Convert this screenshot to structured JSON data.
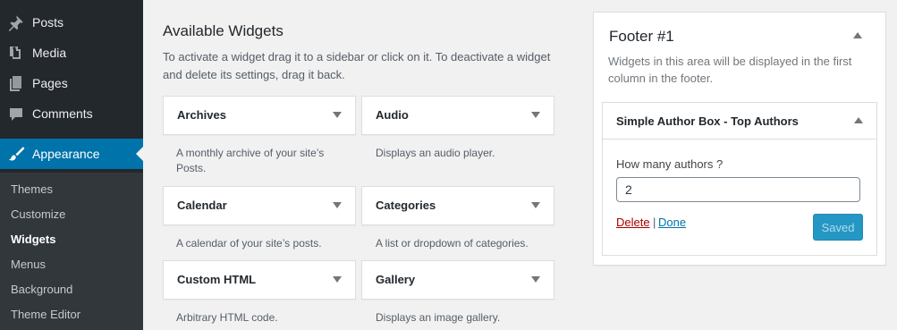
{
  "sidebar": {
    "menu": [
      {
        "label": "Posts",
        "icon": "pushpin-icon"
      },
      {
        "label": "Media",
        "icon": "media-icon"
      },
      {
        "label": "Pages",
        "icon": "pages-icon"
      },
      {
        "label": "Comments",
        "icon": "comment-icon"
      },
      {
        "label": "Appearance",
        "icon": "paintbrush-icon",
        "active": true
      }
    ],
    "submenu": [
      "Themes",
      "Customize",
      "Widgets",
      "Menus",
      "Background",
      "Theme Editor"
    ],
    "current_submenu": "Widgets"
  },
  "available": {
    "title": "Available Widgets",
    "description": "To activate a widget drag it to a sidebar or click on it. To deactivate a widget and delete its settings, drag it back.",
    "widgets": [
      {
        "title": "Archives",
        "description": "A monthly archive of your site’s Posts."
      },
      {
        "title": "Audio",
        "description": "Displays an audio player."
      },
      {
        "title": "Calendar",
        "description": "A calendar of your site’s posts."
      },
      {
        "title": "Categories",
        "description": "A list or dropdown of categories."
      },
      {
        "title": "Custom HTML",
        "description": "Arbitrary HTML code."
      },
      {
        "title": "Gallery",
        "description": "Displays an image gallery."
      }
    ]
  },
  "footer_sidebar": {
    "title": "Footer #1",
    "description": "Widgets in this area will be displayed in the first column in the footer.",
    "widget": {
      "title": "Simple Author Box - Top Authors",
      "field_label": "How many authors ?",
      "field_value": "2",
      "delete_label": "Delete",
      "separator": "|",
      "done_label": "Done",
      "save_label": "Saved"
    }
  },
  "colors": {
    "sidebar_bg": "#23282d",
    "accent": "#0073aa",
    "delete": "#aa0000"
  }
}
